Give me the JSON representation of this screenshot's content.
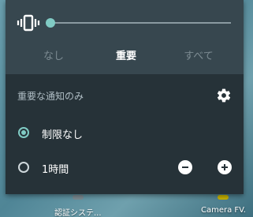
{
  "volume_row": {
    "icon": "vibrate-icon",
    "slider_level": 0.0
  },
  "tabs": [
    {
      "label": "なし",
      "active": false
    },
    {
      "label": "重要",
      "active": true
    },
    {
      "label": "すべて",
      "active": false
    }
  ],
  "section": {
    "label": "重要な通知のみ",
    "settings_icon": "gear-icon"
  },
  "options": [
    {
      "label": "制限なし",
      "checked": true
    },
    {
      "label": "1時間",
      "checked": false
    }
  ],
  "duration_controls": {
    "decrease_icon": "minus-circle-icon",
    "increase_icon": "plus-circle-icon"
  },
  "home_apps": [
    {
      "label": "認証システ..."
    },
    {
      "label": "Camera FV."
    }
  ],
  "colors": {
    "accent": "#80cbc4",
    "panel_bg": "#263238",
    "top_bg": "#37474f"
  }
}
